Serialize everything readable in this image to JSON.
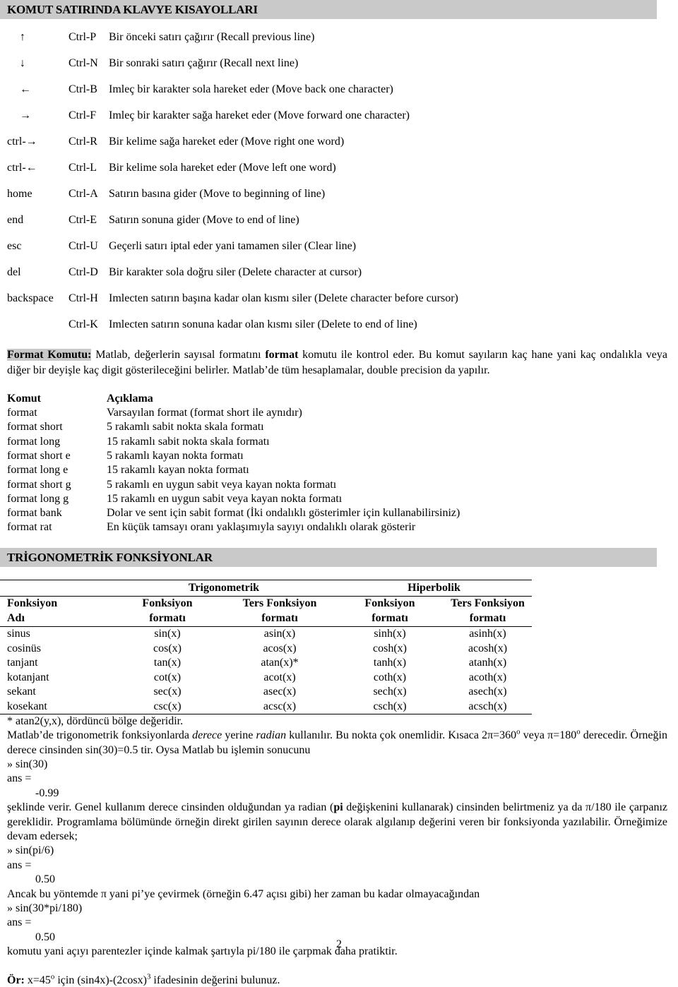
{
  "shortcuts_section": {
    "title": "KOMUT SATIRINDA KLAVYE KISAYOLLARI",
    "rows": [
      {
        "key": "↑",
        "ctrl": "Ctrl-P",
        "desc": "Bir önceki satırı çağırır (Recall previous line)"
      },
      {
        "key": "↓",
        "ctrl": "Ctrl-N",
        "desc": "Bir sonraki satırı çağırır  (Recall next line)"
      },
      {
        "key": "←",
        "ctrl": "Ctrl-B",
        "desc": "Imleç bir karakter sola hareket eder (Move back one character)"
      },
      {
        "key": "→",
        "ctrl": "Ctrl-F",
        "desc": "Imleç bir karakter sağa hareket eder  (Move forward one character)"
      },
      {
        "key": "ctrl-→",
        "ctrl": "Ctrl-R",
        "desc": "Bir kelime sağa hareket eder (Move right one word)"
      },
      {
        "key": "ctrl-←",
        "ctrl": "Ctrl-L",
        "desc": "Bir kelime sola hareket eder (Move left one word)"
      },
      {
        "key": "home",
        "ctrl": "Ctrl-A",
        "desc": "Satırın basına gider (Move to beginning of line)"
      },
      {
        "key": "end",
        "ctrl": "Ctrl-E",
        "desc": "Satırın sonuna gider (Move to end of line)"
      },
      {
        "key": "esc",
        "ctrl": "Ctrl-U",
        "desc": "Geçerli satırı iptal eder yani tamamen siler (Clear line)"
      },
      {
        "key": "del",
        "ctrl": "Ctrl-D",
        "desc": "Bir karakter sola doğru siler (Delete character at cursor)"
      },
      {
        "key": "backspace",
        "ctrl": "Ctrl-H",
        "desc": "Imlecten satırın başına kadar olan kısmı siler (Delete character before cursor)"
      },
      {
        "key": "",
        "ctrl": "Ctrl-K",
        "desc": "Imlecten satırın sonuna kadar olan kısmı siler (Delete to end of line)"
      }
    ]
  },
  "format_section": {
    "lead_label": "Format Komutu:",
    "paragraph_part1": " Matlab, değerlerin sayısal formatını ",
    "paragraph_bold": "format",
    "paragraph_part2": " komutu ile kontrol eder. Bu komut sayıların kaç hane yani kaç ondalıkla veya diğer bir deyişle kaç digit gösterileceğini belirler. Matlab’de tüm hesaplamalar, double precision da yapılır.",
    "table_headers": {
      "command": "Komut",
      "description": "Açıklama"
    },
    "rows": [
      {
        "command": "format",
        "description": "Varsayılan format (format short ile aynıdır)"
      },
      {
        "command": "format short",
        "description": "5 rakamlı sabit nokta skala formatı"
      },
      {
        "command": "format long",
        "description": "15 rakamlı sabit nokta skala formatı"
      },
      {
        "command": "format short e",
        "description": "5 rakamlı kayan nokta formatı"
      },
      {
        "command": "format long e",
        "description": "15 rakamlı kayan nokta formatı"
      },
      {
        "command": "format short g",
        "description": "5 rakamlı en uygun sabit veya kayan nokta formatı"
      },
      {
        "command": "format long g",
        "description": "15 rakamlı en uygun sabit veya kayan nokta formatı"
      },
      {
        "command": "format bank",
        "description": "Dolar ve sent için sabit format (İki ondalıklı gösterimler için kullanabilirsiniz)"
      },
      {
        "command": "format rat",
        "description": "En küçük tamsayı oranı yaklaşımıyla sayıyı ondalıklı olarak gösterir"
      }
    ]
  },
  "trig_section": {
    "title": "TRİGONOMETRİK FONKSİYONLAR",
    "group_headers": {
      "blank": "",
      "trigonometric": "Trigonometrik",
      "hyperbolic": "Hiperbolik"
    },
    "column_headers_line1": [
      "Fonksiyon",
      "Fonksiyon",
      "Ters Fonksiyon",
      "Fonksiyon",
      "Ters Fonksiyon"
    ],
    "column_headers_line2": [
      "Adı",
      "formatı",
      "formatı",
      "formatı",
      "formatı"
    ],
    "rows": [
      [
        "sinus",
        "sin(x)",
        "asin(x)",
        "sinh(x)",
        "asinh(x)"
      ],
      [
        "cosinüs",
        "cos(x)",
        "acos(x)",
        "cosh(x)",
        "acosh(x)"
      ],
      [
        "tanjant",
        "tan(x)",
        "atan(x)*",
        "tanh(x)",
        "atanh(x)"
      ],
      [
        "kotanjant",
        "cot(x)",
        "acot(x)",
        "coth(x)",
        "acoth(x)"
      ],
      [
        "sekant",
        "sec(x)",
        "asec(x)",
        "sech(x)",
        "asech(x)"
      ],
      [
        "kosekant",
        "csc(x)",
        "acsc(x)",
        "csch(x)",
        "acsch(x)"
      ]
    ],
    "footnote": "* atan2(y,x), dördüncü bölge değeridir."
  },
  "explanation": {
    "p1_a": "Matlab’de trigonometrik fonksiyonlarda ",
    "p1_i1": "derece",
    "p1_b": " yerine ",
    "p1_i2": "radian",
    "p1_c": " kullanılır. Bu nokta çok onemlidir. Kısaca 2π=360",
    "p1_sup1": "o",
    "p1_d": " veya π=180",
    "p1_sup2": "o",
    "p1_e": " derecedir. Örneğin derece cinsinden sin(30)=0.5 tir. Oysa Matlab bu işlemin sonucunu",
    "code1": "» sin(30)",
    "ans1_label": "ans =",
    "ans1_value": "-0.99",
    "p2_a": "şeklinde verir. Genel kullanım derece cinsinden olduğundan ya radian (",
    "p2_b": "pi",
    "p2_c": " değişkenini kullanarak) cinsinden belirtmeniz ya da π/180 ile çarpanız gereklidir. Programlama bölümünde örneğin direkt girilen sayının derece olarak algılanıp değerini veren bir fonksiyonda yazılabilir. Örneğimize devam  edersek;",
    "code2": "» sin(pi/6)",
    "ans2_label": "ans =",
    "ans2_value": "0.50",
    "p3": "Ancak bu yöntemde π yani pi’ye çevirmek (örneğin 6.47 açısı gibi) her zaman bu kadar olmayacağından",
    "code3": "» sin(30*pi/180)",
    "ans3_label": "ans =",
    "ans3_value": "0.50",
    "p4": "komutu yani açıyı parentezler içinde kalmak şartıyla pi/180 ile çarpmak daha pratiktir."
  },
  "example": {
    "label": "Ör:",
    "text_a": " x=45",
    "sup_a": "o",
    "text_b": " için (sin4x)-(2cosx)",
    "sup_b": "3",
    "text_c": " ifadesinin değerini bulunuz."
  },
  "page_number": "2",
  "colors": {
    "highlight": "#c9c9c9",
    "text": "#000000",
    "background": "#ffffff"
  }
}
